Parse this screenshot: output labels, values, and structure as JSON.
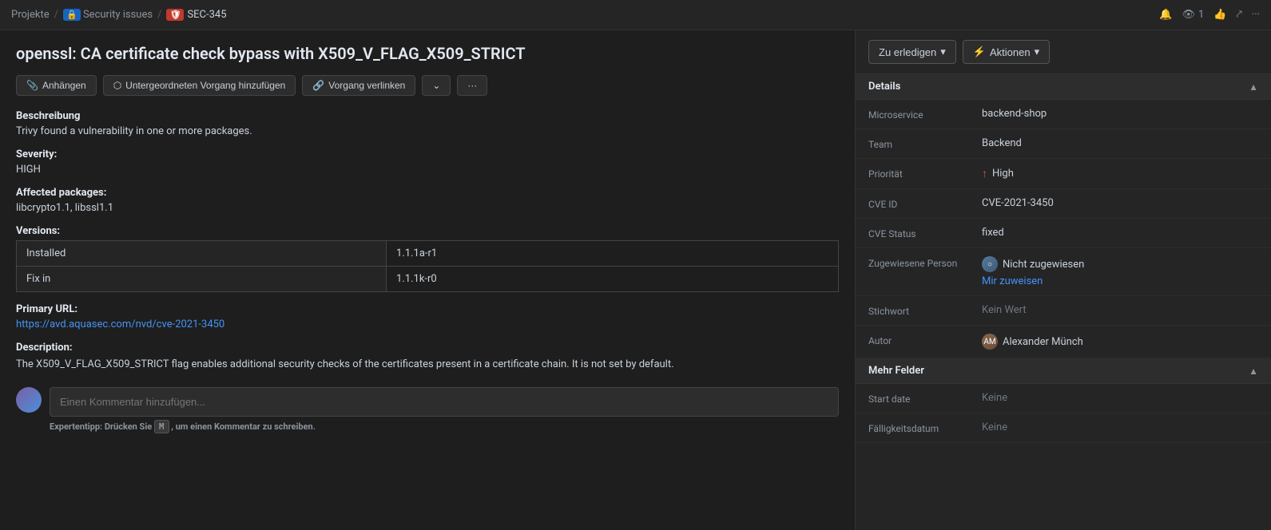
{
  "breadcrumb": {
    "projekte": "Projekte",
    "sep1": "/",
    "security_issues": "Security issues",
    "sep2": "/",
    "sec_id": "SEC-345"
  },
  "topbar_right": {
    "watch_count": "1",
    "bell_icon": "🔔",
    "eye_icon": "👁",
    "thumbs_icon": "👍",
    "share_icon": "⤤",
    "more_icon": "…"
  },
  "issue": {
    "title": "openssl: CA certificate check bypass with X509_V_FLAG_X509_STRICT",
    "actions": {
      "attach": "Anhängen",
      "add_child": "Untergeordneten Vorgang hinzufügen",
      "link": "Vorgang verlinken",
      "more": "···"
    },
    "beschreibung_label": "Beschreibung",
    "beschreibung_text": "Trivy found a vulnerability in one or more packages.",
    "severity_label": "Severity:",
    "severity_value": "HIGH",
    "affected_label": "Affected packages:",
    "affected_value": "libcrypto1.1, libssl1.1",
    "versions_label": "Versions:",
    "versions_table": [
      {
        "label": "Installed",
        "value": "1.1.1a-r1"
      },
      {
        "label": "Fix in",
        "value": "1.1.1k-r0"
      }
    ],
    "primary_url_label": "Primary URL:",
    "primary_url": "https://avd.aquasec.com/nvd/cve-2021-3450",
    "description_label": "Description:",
    "description_text": "The X509_V_FLAG_X509_STRICT flag enables additional security checks of the certificates present in a certificate chain. It is not set by default.",
    "comment_placeholder": "Einen Kommentar hinzufügen...",
    "expert_tip": "Expertentipp: Drücken Sie",
    "expert_key": "M",
    "expert_tip_end": ", um einen Kommentar zu schreiben."
  },
  "right_panel": {
    "status_btn": "Zu erledigen",
    "actions_btn": "Aktionen",
    "details_section_label": "Details",
    "details": {
      "microservice_key": "Microservice",
      "microservice_val": "backend-shop",
      "team_key": "Team",
      "team_val": "Backend",
      "prioritaet_key": "Priorität",
      "prioritaet_val": "High",
      "cve_id_key": "CVE ID",
      "cve_id_val": "CVE-2021-3450",
      "cve_status_key": "CVE Status",
      "cve_status_val": "fixed",
      "zugewiesene_key": "Zugewiesene Person",
      "zugewiesene_val": "Nicht zugewiesen",
      "mir_zuweisen": "Mir zuweisen",
      "stichwort_key": "Stichwort",
      "stichwort_val": "Kein Wert",
      "autor_key": "Autor",
      "autor_val": "Alexander Münch"
    },
    "mehr_felder_label": "Mehr Felder",
    "mehr_felder": {
      "start_date_key": "Start date",
      "start_date_val": "Keine",
      "faelligkeitsdatum_key": "Fälligkeitsdatum",
      "faelligkeitsdatum_val": "Keine"
    }
  }
}
